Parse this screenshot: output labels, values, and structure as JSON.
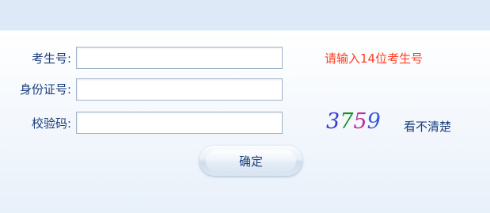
{
  "form": {
    "exam_number_label": "考生号:",
    "id_number_label": "身份证号:",
    "captcha_label": "校验码:",
    "exam_number_value": "",
    "id_number_value": "",
    "captcha_value": "",
    "hint": "请输入14位考生号",
    "captcha_digits": [
      {
        "char": "3",
        "color": "#3a3ad8"
      },
      {
        "char": "7",
        "color": "#1b8f2a"
      },
      {
        "char": "5",
        "color": "#c02c9a"
      },
      {
        "char": "9",
        "color": "#3a5ad8"
      }
    ],
    "refresh_label": "看不清楚",
    "submit_label": "确定"
  },
  "colors": {
    "label": "#1a3d7c",
    "hint": "#ff3b1f",
    "header_band": "#dde9f6"
  }
}
